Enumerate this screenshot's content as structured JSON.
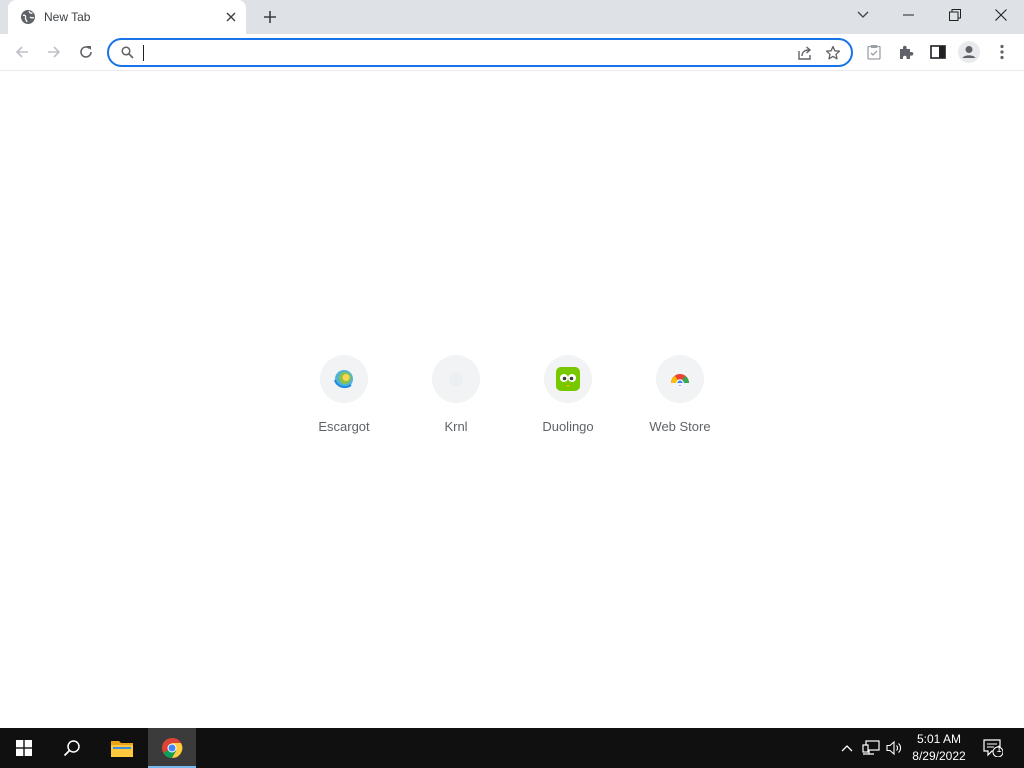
{
  "browser": {
    "tab": {
      "title": "New Tab"
    },
    "omnibox": {
      "value": "",
      "placeholder": ""
    }
  },
  "shortcuts": [
    {
      "label": "Escargot",
      "icon": "escargot-icon"
    },
    {
      "label": "Krnl",
      "icon": "krnl-icon"
    },
    {
      "label": "Duolingo",
      "icon": "duolingo-icon"
    },
    {
      "label": "Web Store",
      "icon": "web-store-icon"
    }
  ],
  "taskbar": {
    "time": "5:01 AM",
    "date": "8/29/2022",
    "notification_count": "1"
  },
  "colors": {
    "accent": "#1a73e8",
    "tabstrip": "#dee1e6",
    "taskbar": "#101010",
    "duolingo": "#78c800"
  }
}
